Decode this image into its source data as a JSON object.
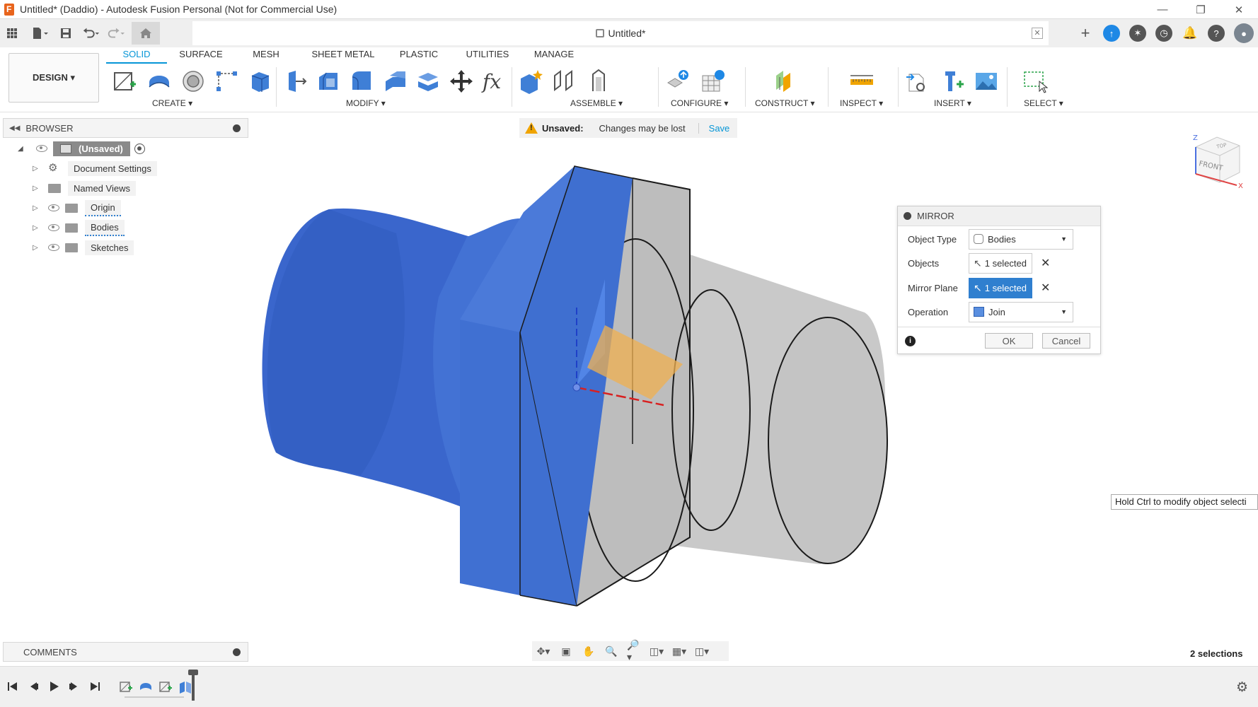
{
  "window": {
    "title": "Untitled* (Daddio) - Autodesk Fusion Personal (Not for Commercial Use)",
    "controls": [
      "minimize",
      "restore",
      "close"
    ]
  },
  "document_tab": {
    "title": "Untitled*",
    "close_label": "✕"
  },
  "workspace": {
    "label": "DESIGN ▾"
  },
  "ribbon_tabs": [
    {
      "label": "SOLID",
      "active": true
    },
    {
      "label": "SURFACE",
      "active": false
    },
    {
      "label": "MESH",
      "active": false
    },
    {
      "label": "SHEET METAL",
      "active": false
    },
    {
      "label": "PLASTIC",
      "active": false
    },
    {
      "label": "UTILITIES",
      "active": false
    },
    {
      "label": "MANAGE",
      "active": false
    }
  ],
  "tool_groups": [
    {
      "label": "CREATE ▾"
    },
    {
      "label": "MODIFY ▾"
    },
    {
      "label": "ASSEMBLE ▾"
    },
    {
      "label": "CONFIGURE ▾"
    },
    {
      "label": "CONSTRUCT ▾"
    },
    {
      "label": "INSPECT ▾"
    },
    {
      "label": "INSERT ▾"
    },
    {
      "label": "SELECT ▾"
    }
  ],
  "browser": {
    "title": "BROWSER",
    "root": "(Unsaved)",
    "nodes": [
      {
        "label": "Document Settings",
        "icon": "gear-icon"
      },
      {
        "label": "Named Views",
        "icon": "folder-icon"
      },
      {
        "label": "Origin",
        "icon": "folder-icon"
      },
      {
        "label": "Bodies",
        "icon": "folder-icon"
      },
      {
        "label": "Sketches",
        "icon": "folder-icon"
      }
    ]
  },
  "unsaved_bar": {
    "title": "Unsaved:",
    "message": "Changes may be lost",
    "save_label": "Save"
  },
  "viewcube": {
    "top": "TOP",
    "front": "FRONT",
    "axis_x": "X",
    "axis_z": "Z"
  },
  "mirror_dialog": {
    "title": "MIRROR",
    "rows": [
      {
        "label": "Object Type",
        "value": "Bodies"
      },
      {
        "label": "Objects",
        "value": "1 selected"
      },
      {
        "label": "Mirror Plane",
        "value": "1 selected"
      },
      {
        "label": "Operation",
        "value": "Join"
      }
    ],
    "ok_label": "OK",
    "cancel_label": "Cancel"
  },
  "tooltip": {
    "text": "Hold Ctrl to modify object selecti"
  },
  "comments": {
    "title": "COMMENTS"
  },
  "status": {
    "selections": "2 selections"
  },
  "colors": {
    "accent": "#0696d7",
    "body_blue": "#3f6fd0",
    "body_gray": "#c9c9c9",
    "warning": "#f0a400",
    "selected_field": "#2f7fcf"
  }
}
